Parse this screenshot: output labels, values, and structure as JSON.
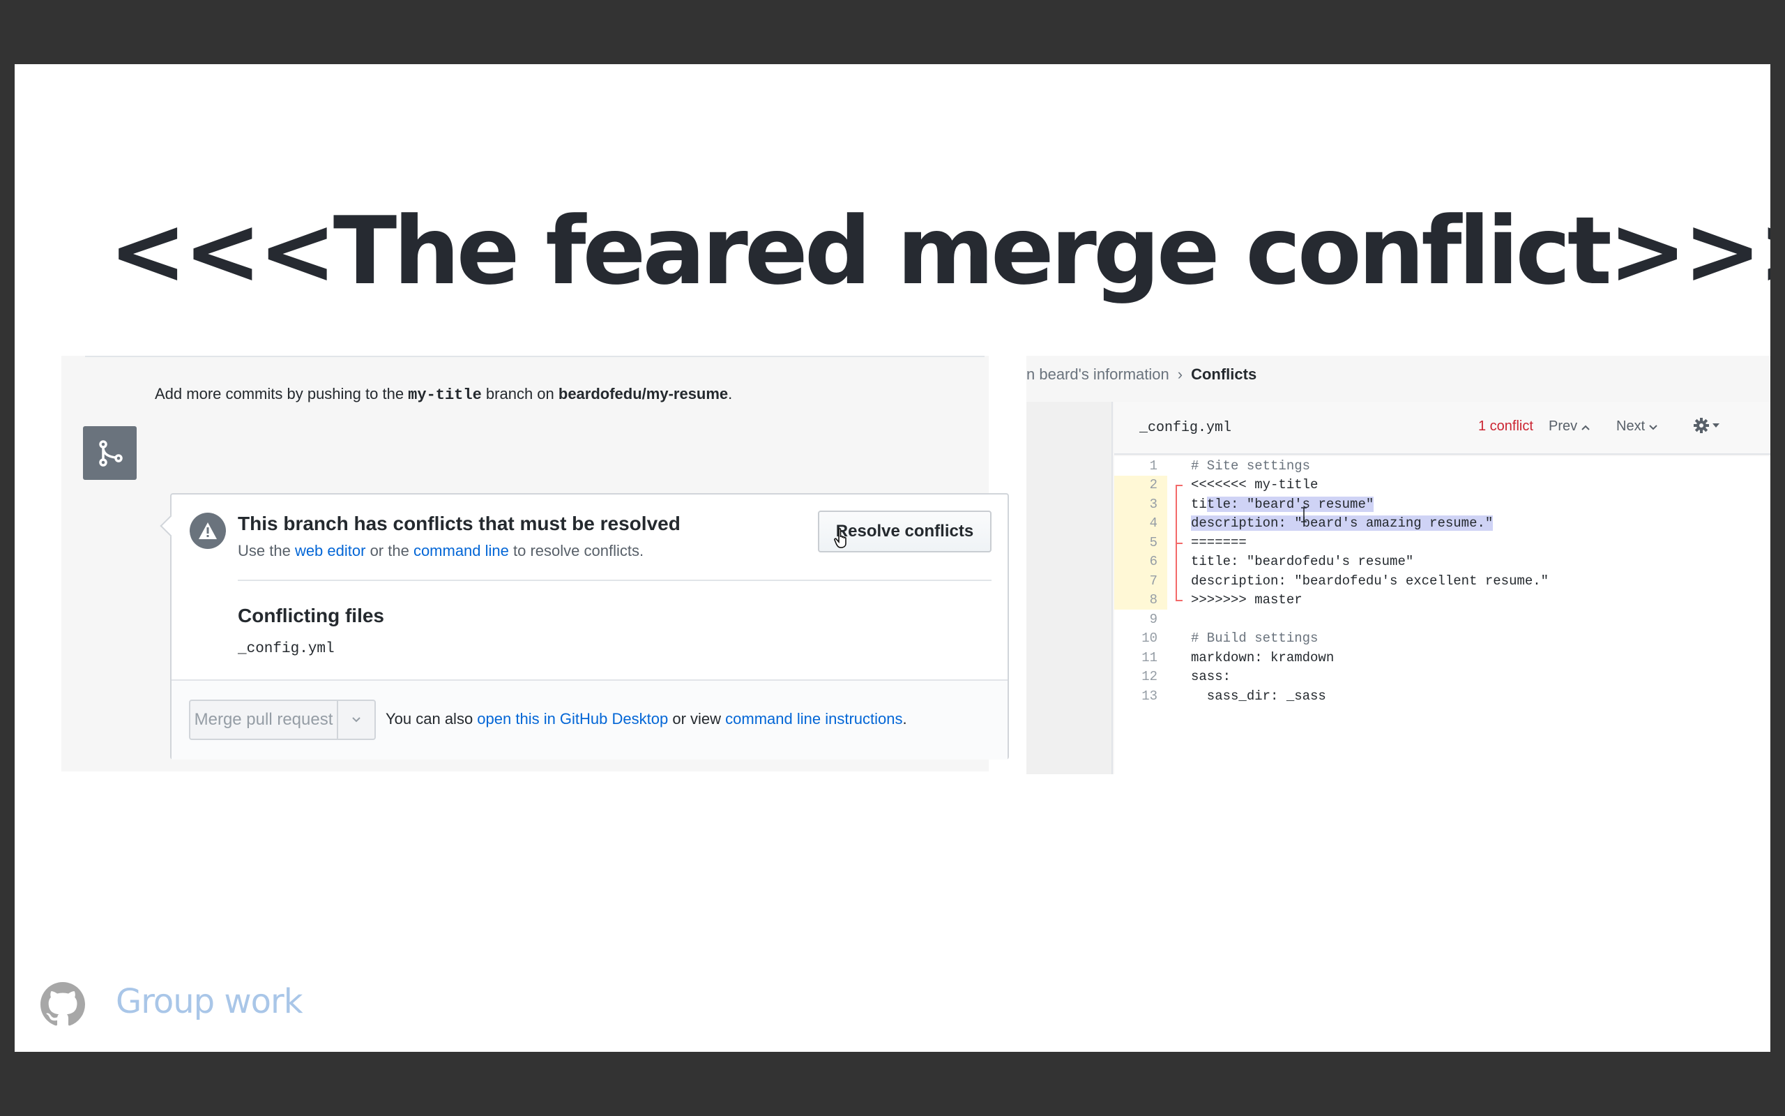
{
  "slide": {
    "title": "<<<The feared merge conflict>>>",
    "footer_label": "Group work",
    "footer_icon": "github-octocat-icon"
  },
  "pr": {
    "hint_prefix": "Add more commits by pushing to the ",
    "hint_branch": "my-title",
    "hint_middle": " branch on ",
    "hint_repo": "beardofedu/my-resume",
    "hint_suffix": ".",
    "conflict_heading": "This branch has conflicts that must be resolved",
    "sub_prefix": "Use the ",
    "sub_link1": "web editor",
    "sub_middle": " or the ",
    "sub_link2": "command line",
    "sub_suffix": " to resolve conflicts.",
    "resolve_button": "Resolve conflicts",
    "files_title": "Conflicting files",
    "files": [
      "_config.yml"
    ],
    "merge_button": "Merge pull request",
    "footer_prefix": "You can also ",
    "footer_link1": "open this in GitHub Desktop",
    "footer_middle": " or view ",
    "footer_link2": "command line instructions",
    "footer_suffix": "."
  },
  "editor": {
    "breadcrumb_parent": "n beard's information",
    "breadcrumb_current": "Conflicts",
    "file_name": "_config.yml",
    "conflict_count": "1 conflict",
    "prev_label": "Prev",
    "next_label": "Next",
    "lines": [
      {
        "n": "1",
        "text": "# Site settings"
      },
      {
        "n": "2",
        "text": "<<<<<<< my-title"
      },
      {
        "n": "3",
        "text_pre": "ti",
        "text_sel": "tle: \"beard's resume\""
      },
      {
        "n": "4",
        "text_sel": "description: \"beard's amazing resume.\""
      },
      {
        "n": "5",
        "text": "======="
      },
      {
        "n": "6",
        "text": "title: \"beardofedu's resume\""
      },
      {
        "n": "7",
        "text": "description: \"beardofedu's excellent resume.\""
      },
      {
        "n": "8",
        "text": ">>>>>>> master"
      },
      {
        "n": "9",
        "text": ""
      },
      {
        "n": "10",
        "text": "# Build settings"
      },
      {
        "n": "11",
        "text": "markdown: kramdown"
      },
      {
        "n": "12",
        "text": "sass:"
      },
      {
        "n": "13",
        "text": "  sass_dir: _sass"
      }
    ]
  },
  "colors": {
    "link": "#0366d6",
    "conflict_red": "#cb2431",
    "conflict_gutter": "#fff8d6",
    "selection": "#cfd3f5",
    "footer_label": "#a9c6e8"
  }
}
